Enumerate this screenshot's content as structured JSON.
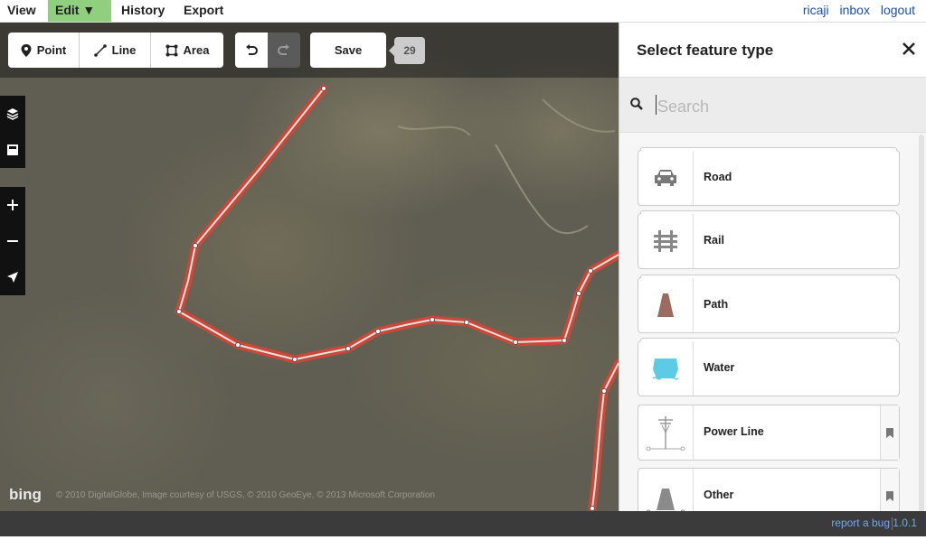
{
  "menu": {
    "items": [
      {
        "label": "View",
        "active": false
      },
      {
        "label": "Edit ▼",
        "active": true
      },
      {
        "label": "History",
        "active": false
      },
      {
        "label": "Export",
        "active": false
      }
    ],
    "user_links": [
      "ricaji",
      "inbox",
      "logout"
    ]
  },
  "toolbar": {
    "point_label": "Point",
    "line_label": "Line",
    "area_label": "Area",
    "save_label": "Save",
    "change_count": "29"
  },
  "map": {
    "provider_logo": "bing",
    "attribution": "© 2010 DigitalGlobe, Image courtesy of USGS, © 2010 GeoEye, © 2013 Microsoft Corporation",
    "highlight_color": "#d84f3a"
  },
  "footer": {
    "report_bug": "report a bug",
    "version": "1.0.1"
  },
  "panel": {
    "title": "Select feature type",
    "search_placeholder": "Search",
    "presets": [
      {
        "label": "Road",
        "icon": "car-icon",
        "category": true
      },
      {
        "label": "Rail",
        "icon": "rail-icon",
        "category": true
      },
      {
        "label": "Path",
        "icon": "path-icon",
        "category": true
      },
      {
        "label": "Water",
        "icon": "water-icon",
        "category": true
      },
      {
        "label": "Power Line",
        "icon": "power-line-icon",
        "category": false
      },
      {
        "label": "Other",
        "icon": "other-icon",
        "category": false
      }
    ]
  },
  "colors": {
    "edit_active": "#8fcf7e",
    "link": "#1a4fb0",
    "footer_link": "#6fa6ff"
  }
}
